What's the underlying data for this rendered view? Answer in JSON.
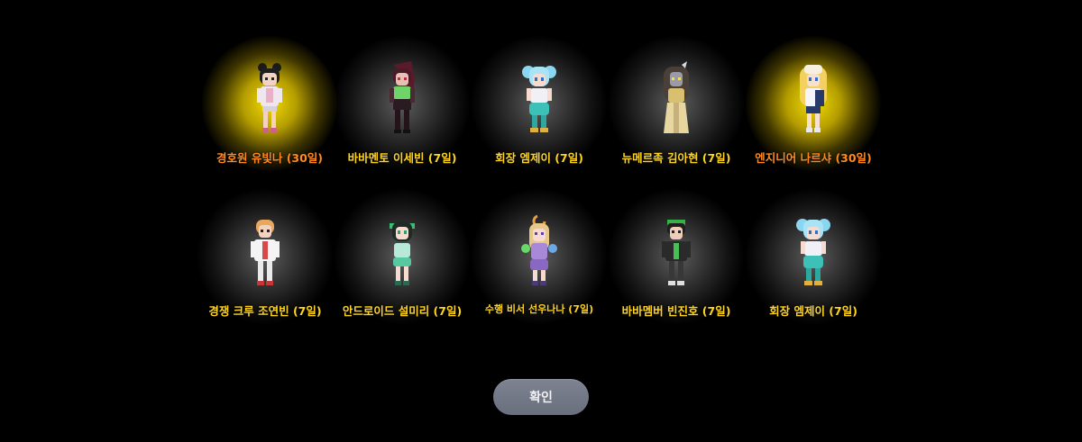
{
  "rewards": {
    "row1": [
      {
        "label": "경호원 유빛나 (30일)",
        "rarity": "legendary",
        "highlight": "#e6c400",
        "label_color": "#ff8a1f"
      },
      {
        "label": "바바멘토 이세빈 (7일)",
        "rarity": "normal",
        "label_color": "#ffd41f"
      },
      {
        "label": "회장 엠제이 (7일)",
        "rarity": "normal",
        "label_color": "#ffd41f"
      },
      {
        "label": "뉴메르족 김아현 (7일)",
        "rarity": "normal",
        "label_color": "#ffd41f"
      },
      {
        "label": "엔지니어 나르샤 (30일)",
        "rarity": "legendary",
        "highlight": "#e6c400",
        "label_color": "#ff8a1f"
      }
    ],
    "row2": [
      {
        "label": "경쟁 크루 조연빈 (7일)",
        "rarity": "normal",
        "label_color": "#ffd41f"
      },
      {
        "label": "안드로이드 설미리 (7일)",
        "rarity": "normal",
        "label_color": "#ffd41f"
      },
      {
        "label": "수행 비서 선우나나 (7일)",
        "rarity": "normal",
        "label_color": "#ffd41f"
      },
      {
        "label": "바바멤버 빈진호 (7일)",
        "rarity": "normal",
        "label_color": "#ffd41f"
      },
      {
        "label": "회장 엠제이 (7일)",
        "rarity": "normal",
        "label_color": "#ffd41f"
      }
    ]
  },
  "confirm_label": "확인"
}
